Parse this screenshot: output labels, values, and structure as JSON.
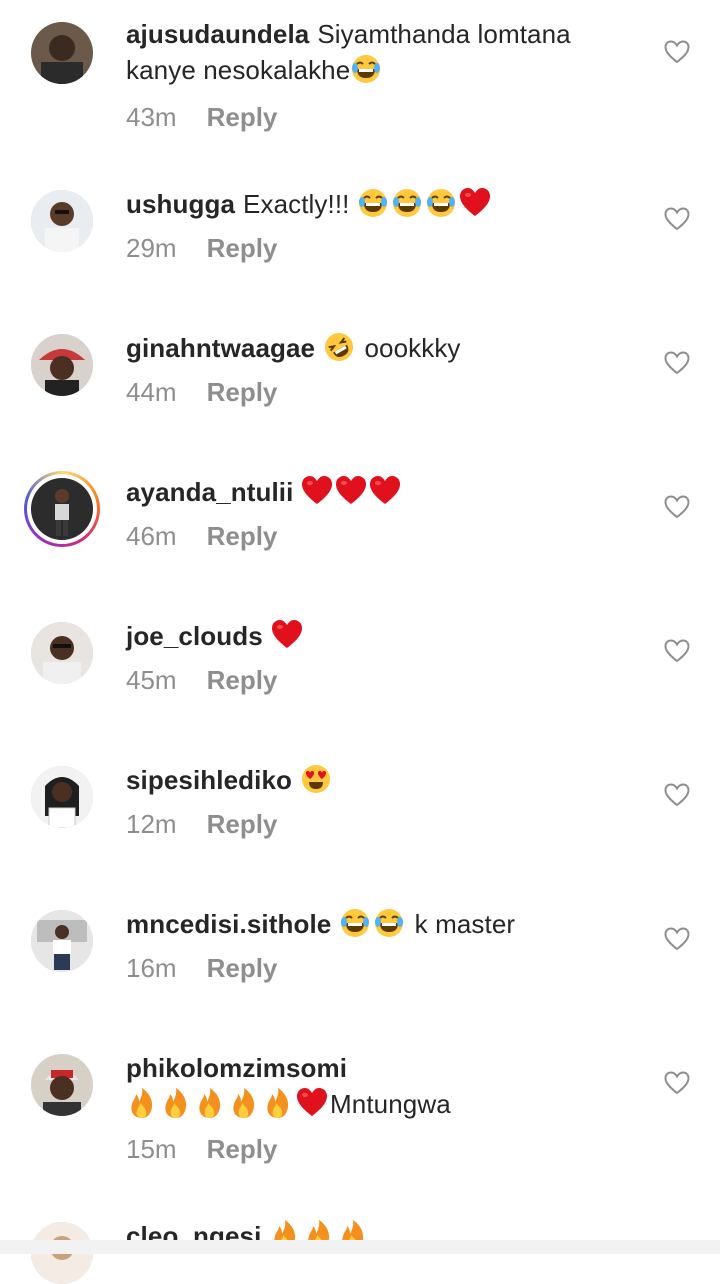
{
  "comments": [
    {
      "user": "ajusudaundela",
      "text": "Siyamthanda lomtana kanye nesokalakhe",
      "time": "43m",
      "reply": "Reply"
    },
    {
      "user": "ushugga",
      "text": "Exactly!!!",
      "time": "29m",
      "reply": "Reply"
    },
    {
      "user": "ginahntwaagae",
      "text": "oookkky",
      "time": "44m",
      "reply": "Reply"
    },
    {
      "user": "ayanda_ntulii",
      "text": "",
      "time": "46m",
      "reply": "Reply"
    },
    {
      "user": "joe_clouds",
      "text": "",
      "time": "45m",
      "reply": "Reply"
    },
    {
      "user": "sipesihlediko",
      "text": "",
      "time": "12m",
      "reply": "Reply"
    },
    {
      "user": "mncedisi.sithole",
      "text": "k master",
      "time": "16m",
      "reply": "Reply"
    },
    {
      "user": "phikolomzimsomi",
      "text": "Mntungwa",
      "time": "15m",
      "reply": "Reply"
    },
    {
      "user": "cleo_ngesi",
      "text": "",
      "time": "",
      "reply": ""
    }
  ],
  "colors": {
    "text": "#262626",
    "meta": "#8e8e8e",
    "heart_icon": "#8e8e8e"
  }
}
